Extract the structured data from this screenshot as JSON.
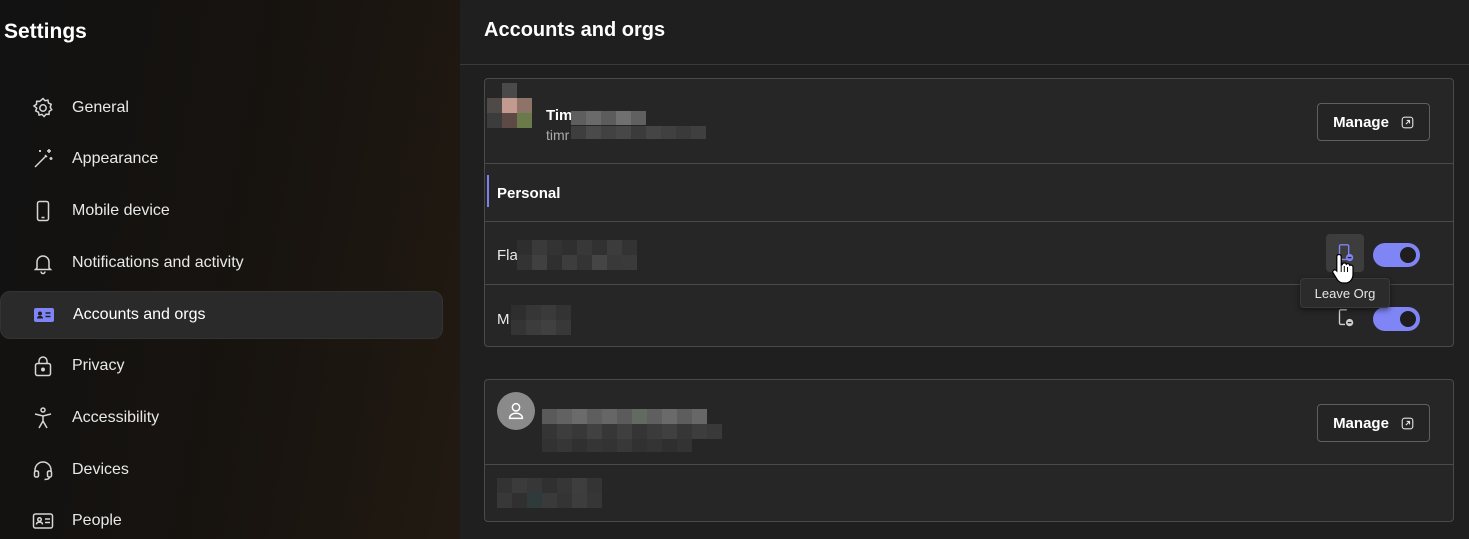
{
  "sidebar": {
    "title": "Settings",
    "items": [
      {
        "label": "General",
        "icon": "gear-icon"
      },
      {
        "label": "Appearance",
        "icon": "magic-wand-icon"
      },
      {
        "label": "Mobile device",
        "icon": "phone-icon"
      },
      {
        "label": "Notifications and activity",
        "icon": "bell-icon"
      },
      {
        "label": "Accounts and orgs",
        "icon": "contact-card-icon",
        "active": true
      },
      {
        "label": "Privacy",
        "icon": "lock-icon"
      },
      {
        "label": "Accessibility",
        "icon": "accessibility-icon"
      },
      {
        "label": "Devices",
        "icon": "headset-icon"
      },
      {
        "label": "People",
        "icon": "people-card-icon"
      }
    ]
  },
  "main": {
    "title": "Accounts and orgs",
    "account1": {
      "name_visible": "Tim",
      "email_visible": "timr",
      "manage_label": "Manage",
      "section_label": "Personal",
      "orgs": [
        {
          "label_visible": "Fla",
          "toggle_on": true
        },
        {
          "label_visible": "M",
          "toggle_on": true
        }
      ]
    },
    "account2": {
      "manage_label": "Manage"
    },
    "tooltip": "Leave Org"
  },
  "colors": {
    "accent": "#7f85f5",
    "sidebar_active_icon": "#7f85f5",
    "background": "#1f1f1f",
    "card": "#262626"
  }
}
